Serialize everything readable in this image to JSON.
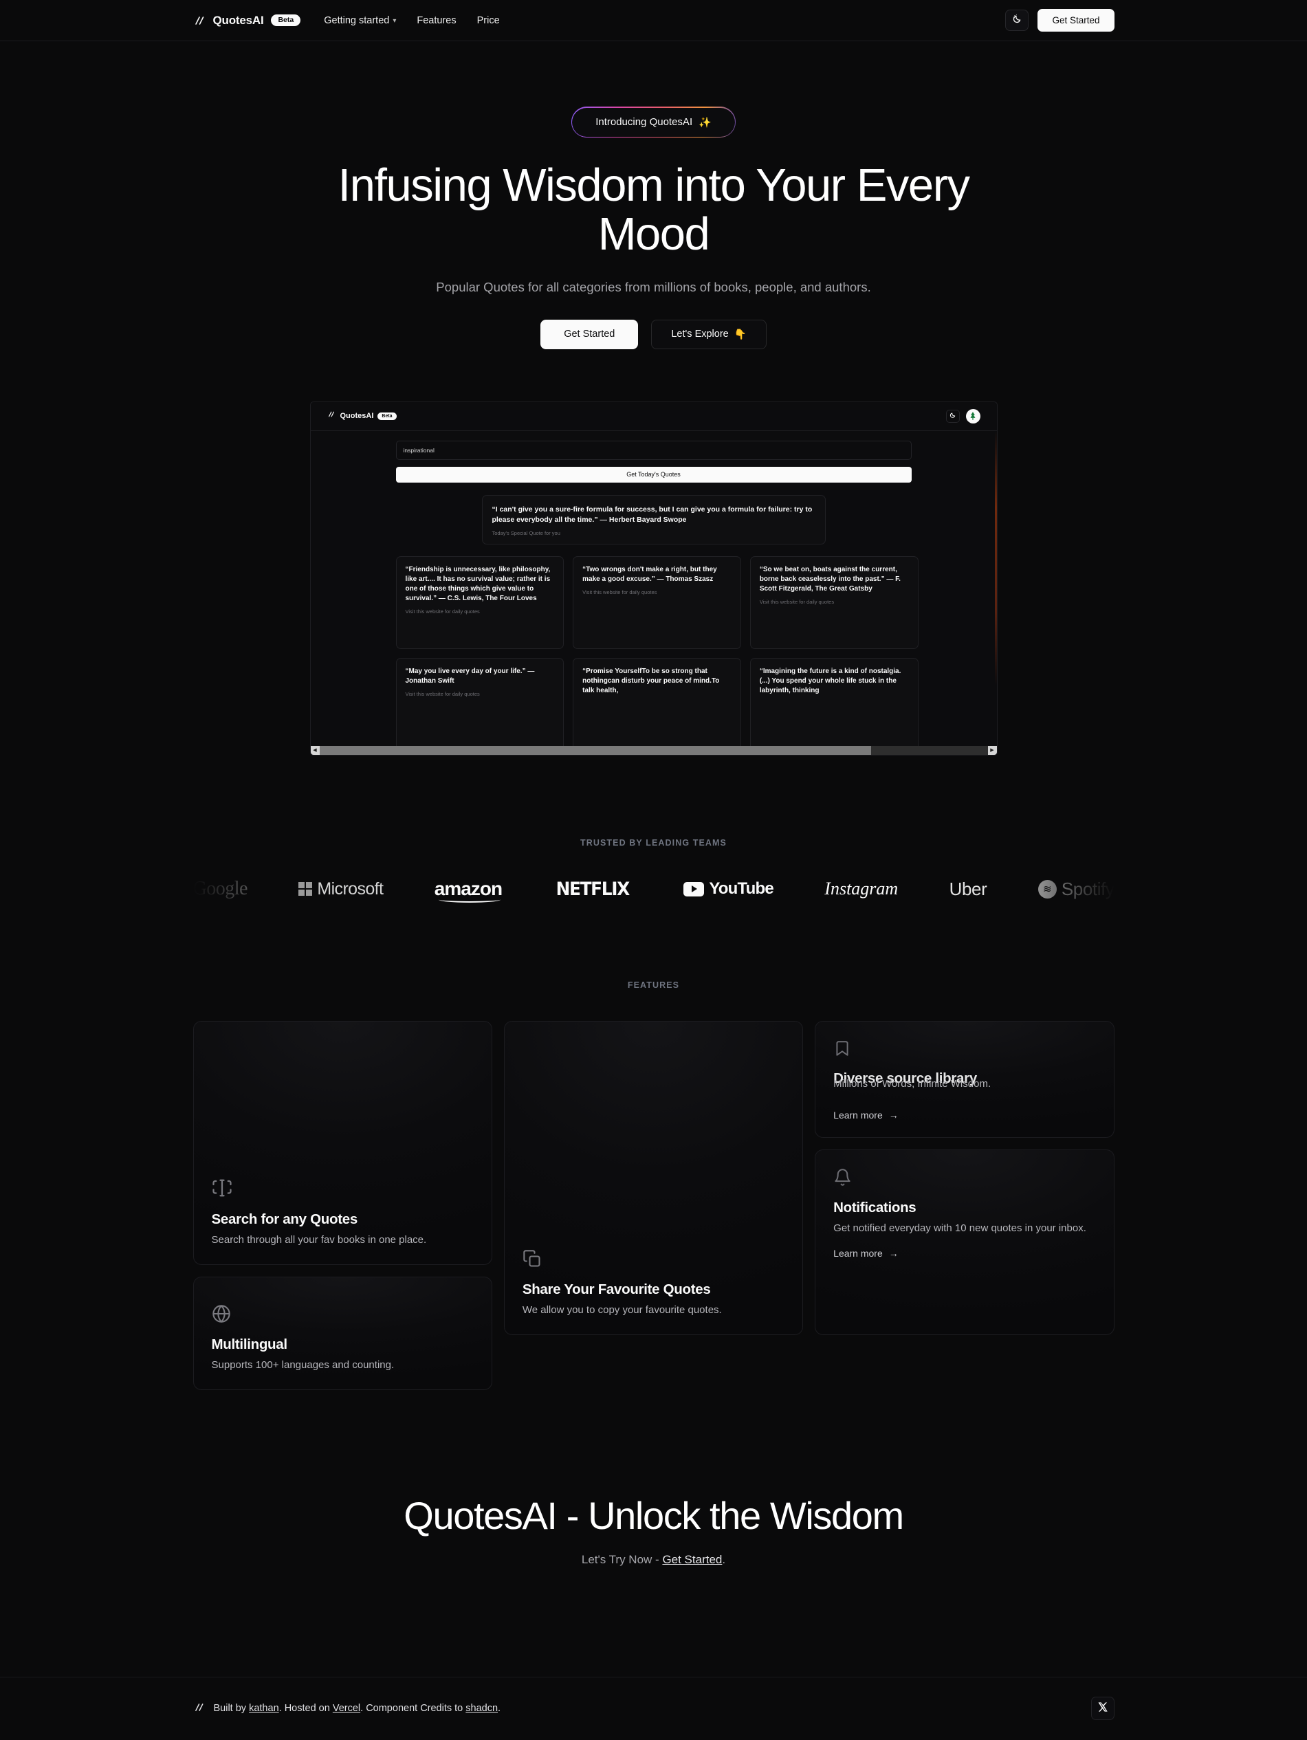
{
  "nav": {
    "brand": "QuotesAI",
    "beta": "Beta",
    "links": [
      {
        "label": "Getting started",
        "has_chevron": true
      },
      {
        "label": "Features",
        "has_chevron": false
      },
      {
        "label": "Price",
        "has_chevron": false
      }
    ],
    "theme_toggle_icon": "moon-stars-icon",
    "cta": "Get Started"
  },
  "hero": {
    "badge": "Introducing QuotesAI",
    "badge_emoji": "✨",
    "title": "Infusing Wisdom into Your Every Mood",
    "subtitle": "Popular Quotes for all categories from millions of books, people, and authors.",
    "primary_cta": "Get Started",
    "secondary_cta": "Let's Explore",
    "secondary_cta_emoji": "👇"
  },
  "preview": {
    "brand": "QuotesAI",
    "beta": "Beta",
    "search_value": "inspirational",
    "cta": "Get Today's Quotes",
    "special": {
      "quote": "“I can't give you a sure-fire formula for success, but I can give you a formula for failure: try to please everybody all the time.”  — Herbert Bayard Swope",
      "meta": "Today's Special Quote for you"
    },
    "card_meta": "Visit this website for daily quotes",
    "cards": [
      {
        "quote": "“Friendship is unnecessary, like philosophy, like art.... It has no survival value; rather it is one of those things which give value to survival.” — C.S. Lewis, The Four Loves"
      },
      {
        "quote": "“Two wrongs don't make a right, but they make a good excuse.” — Thomas Szasz"
      },
      {
        "quote": "“So we beat on, boats against the current, borne back ceaselessly into the past.” — F. Scott Fitzgerald, The Great Gatsby"
      },
      {
        "quote": "“May you live every day of your life.” — Jonathan Swift"
      },
      {
        "quote": "“Promise YourselfTo be so strong that nothingcan disturb your peace of mind.To talk health,"
      },
      {
        "quote": "“Imagining the future is a kind of nostalgia. (...) You spend your whole life stuck in the labyrinth, thinking"
      }
    ]
  },
  "logos": {
    "eyebrow": "TRUSTED BY LEADING TEAMS",
    "items": [
      {
        "name": "Google"
      },
      {
        "name": "Microsoft"
      },
      {
        "name": "amazon"
      },
      {
        "name": "NETFLIX"
      },
      {
        "name": "YouTube"
      },
      {
        "name": "Instagram"
      },
      {
        "name": "Uber"
      },
      {
        "name": "Spotify"
      }
    ]
  },
  "features": {
    "eyebrow": "FEATURES",
    "learn_more": "Learn more",
    "cards": {
      "search": {
        "icon": "text-cursor-input-icon",
        "title": "Search for any Quotes",
        "desc": "Search through all your fav books in one place."
      },
      "multilingual": {
        "icon": "globe-icon",
        "title": "Multilingual",
        "desc": "Supports 100+ languages and counting."
      },
      "share": {
        "icon": "copy-icon",
        "title": "Share Your Favourite Quotes",
        "desc": "We allow you to copy your favourite quotes."
      },
      "library": {
        "icon": "bookmark-icon",
        "title": "Diverse source library",
        "desc": "Millions of Words, Infinite Wisdom."
      },
      "notifications": {
        "icon": "bell-icon",
        "title": "Notifications",
        "desc": "Get notified everyday with 10 new quotes in your inbox."
      }
    }
  },
  "cta": {
    "title": "QuotesAI - Unlock the Wisdom",
    "sub_prefix": "Let's Try Now - ",
    "sub_link": "Get Started",
    "sub_suffix": "."
  },
  "footer": {
    "text_1": "Built by ",
    "link_1": "kathan",
    "text_2": ". Hosted on ",
    "link_2": "Vercel",
    "text_3": ". Component Credits to ",
    "link_3": "shadcn",
    "text_4": ".",
    "social_icon": "x-twitter-icon"
  },
  "colors": {
    "background": "#0a0a0b",
    "surface": "#0c0c0e",
    "border": "#1c1c20",
    "text": "#fafafa",
    "muted": "#a3a3a8",
    "accent_white": "#fafafa"
  }
}
